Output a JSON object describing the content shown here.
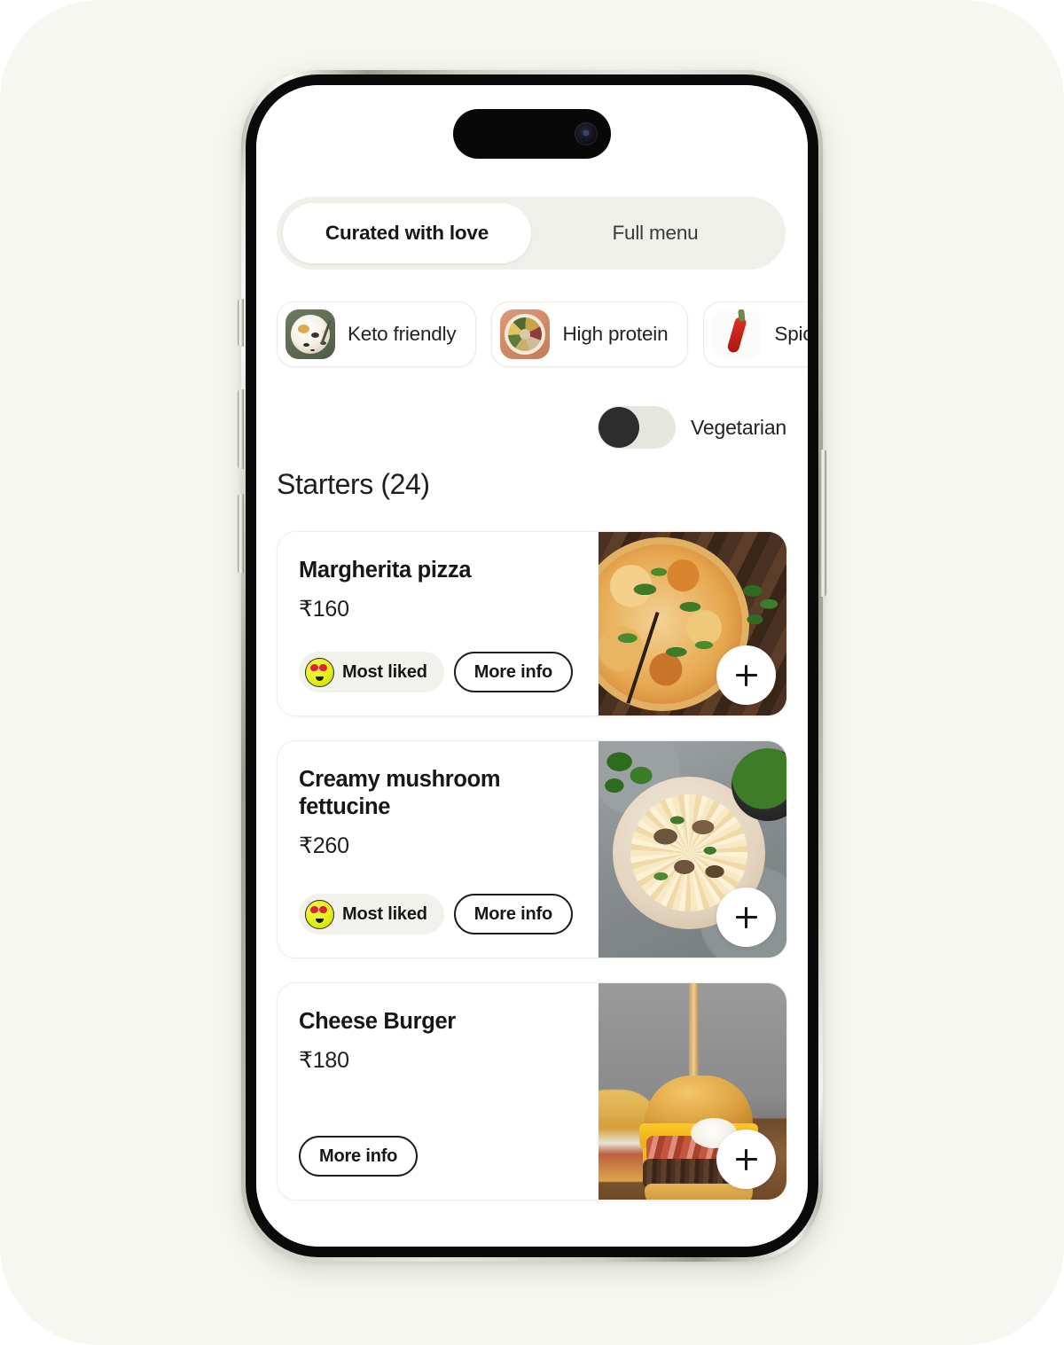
{
  "app": {
    "tabs": [
      {
        "label": "Curated with love",
        "active": true
      },
      {
        "label": "Full menu",
        "active": false
      }
    ],
    "filter_chips": [
      {
        "label": "Keto friendly",
        "icon": "keto-bowl-thumbnail"
      },
      {
        "label": "High protein",
        "icon": "protein-plate-thumbnail"
      },
      {
        "label": "Spicy",
        "icon": "chili-pepper-thumbnail"
      }
    ],
    "vegetarian_toggle": {
      "label": "Vegetarian",
      "state": "off"
    },
    "section": {
      "title": "Starters (24)",
      "name": "Starters",
      "count": 24
    },
    "items": [
      {
        "name": "Margherita pizza",
        "price": "₹160",
        "badge": {
          "label": "Most liked",
          "emoji": "heart-eyes-emoji"
        },
        "more_info_label": "More info",
        "add_label": "+",
        "photo": "margherita-pizza-photo"
      },
      {
        "name": "Creamy mushroom fettucine",
        "price": "₹260",
        "badge": {
          "label": "Most liked",
          "emoji": "heart-eyes-emoji"
        },
        "more_info_label": "More info",
        "add_label": "+",
        "photo": "creamy-mushroom-fettucine-photo"
      },
      {
        "name": "Cheese Burger",
        "price": "₹180",
        "badge": null,
        "more_info_label": "More info",
        "add_label": "+",
        "photo": "cheese-burger-photo"
      }
    ]
  },
  "device": {
    "type": "smartphone",
    "buttons": [
      "action-button",
      "volume-up-button",
      "volume-down-button",
      "power-button"
    ],
    "notch": "dynamic-island"
  },
  "colors": {
    "backdrop": "#f6f7f0",
    "screen": "#ffffff",
    "segmented_track": "#f0f0ea",
    "badge_bg": "#f2f2ec",
    "toggle_track": "#e6e6e0",
    "toggle_knob": "#2d2d2d",
    "text_primary": "#17171a"
  }
}
